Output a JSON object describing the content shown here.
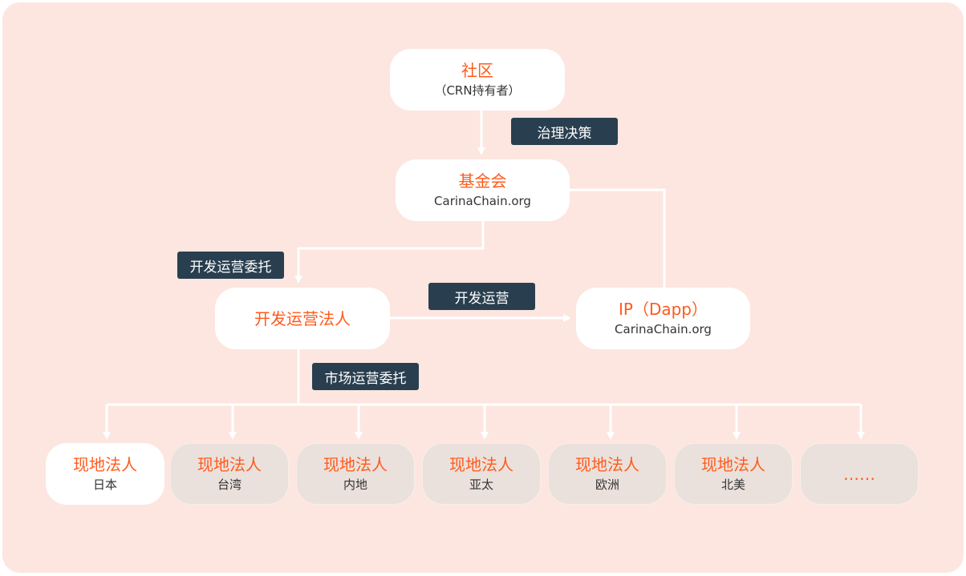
{
  "colors": {
    "background": "#fce6df",
    "node_fill": "#ffffff",
    "node_fill_muted": "#ebe1dc",
    "title_text": "#ff5a1c",
    "badge_fill": "#293f4f",
    "connector": "#ffffff"
  },
  "nodes": {
    "community": {
      "title": "社区",
      "subtitle": "（CRN持有者）"
    },
    "foundation": {
      "title": "基金会",
      "subtitle": "CarinaChain.org"
    },
    "dev_entity": {
      "title": "开发运营法人"
    },
    "ip_dapp": {
      "title": "IP（Dapp）",
      "subtitle": "CarinaChain.org"
    }
  },
  "regional_entities": [
    {
      "title": "现地法人",
      "region": "日本"
    },
    {
      "title": "现地法人",
      "region": "台湾"
    },
    {
      "title": "现地法人",
      "region": "内地"
    },
    {
      "title": "现地法人",
      "region": "亚太"
    },
    {
      "title": "现地法人",
      "region": "欧洲"
    },
    {
      "title": "现地法人",
      "region": "北美"
    },
    {
      "title": "……"
    }
  ],
  "labels": {
    "governance": "治理决策",
    "dev_ops_delegation": "开发运营委托",
    "dev_ops": "开发运营",
    "market_ops_delegation": "市场运营委托"
  }
}
